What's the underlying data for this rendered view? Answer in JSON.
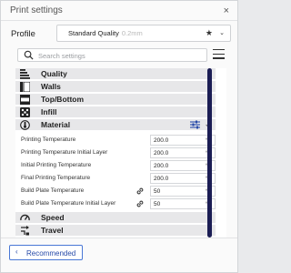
{
  "window": {
    "title": "Print settings",
    "close_glyph": "×"
  },
  "profile": {
    "label": "Profile",
    "selected": "Standard Quality",
    "selected_detail": "0.2mm",
    "favorite_glyph": "★",
    "dropdown_glyph": "⌄"
  },
  "search": {
    "placeholder": "Search settings"
  },
  "chevrons": {
    "collapsed": "‹",
    "expanded": "⌄"
  },
  "categories_top": [
    {
      "label": "Quality",
      "icon": "quality-layers-icon"
    },
    {
      "label": "Walls",
      "icon": "walls-icon"
    },
    {
      "label": "Top/Bottom",
      "icon": "top-bottom-icon"
    },
    {
      "label": "Infill",
      "icon": "infill-icon"
    },
    {
      "label": "Material",
      "icon": "material-thermometer-icon",
      "expanded": true
    }
  ],
  "material_settings": [
    {
      "label": "Printing Temperature",
      "value": "200.0",
      "unit": "°C",
      "linked": false
    },
    {
      "label": "Printing Temperature Initial Layer",
      "value": "200.0",
      "unit": "°C",
      "linked": false
    },
    {
      "label": "Initial Printing Temperature",
      "value": "200.0",
      "unit": "°C",
      "linked": false
    },
    {
      "label": "Final Printing Temperature",
      "value": "200.0",
      "unit": "°C",
      "linked": false
    },
    {
      "label": "Build Plate Temperature",
      "value": "50",
      "unit": "°C",
      "linked": true
    },
    {
      "label": "Build Plate Temperature Initial Layer",
      "value": "50",
      "unit": "°C",
      "linked": true
    }
  ],
  "categories_bottom": [
    {
      "label": "Speed",
      "icon": "speed-gauge-icon"
    },
    {
      "label": "Travel",
      "icon": "travel-icon"
    }
  ],
  "footer": {
    "recommended_label": "Recommended",
    "back_glyph": "‹"
  },
  "colors": {
    "accent": "#274aa8",
    "scrollbar": "#1b1d54",
    "category_bg": "#e7e7e9"
  }
}
